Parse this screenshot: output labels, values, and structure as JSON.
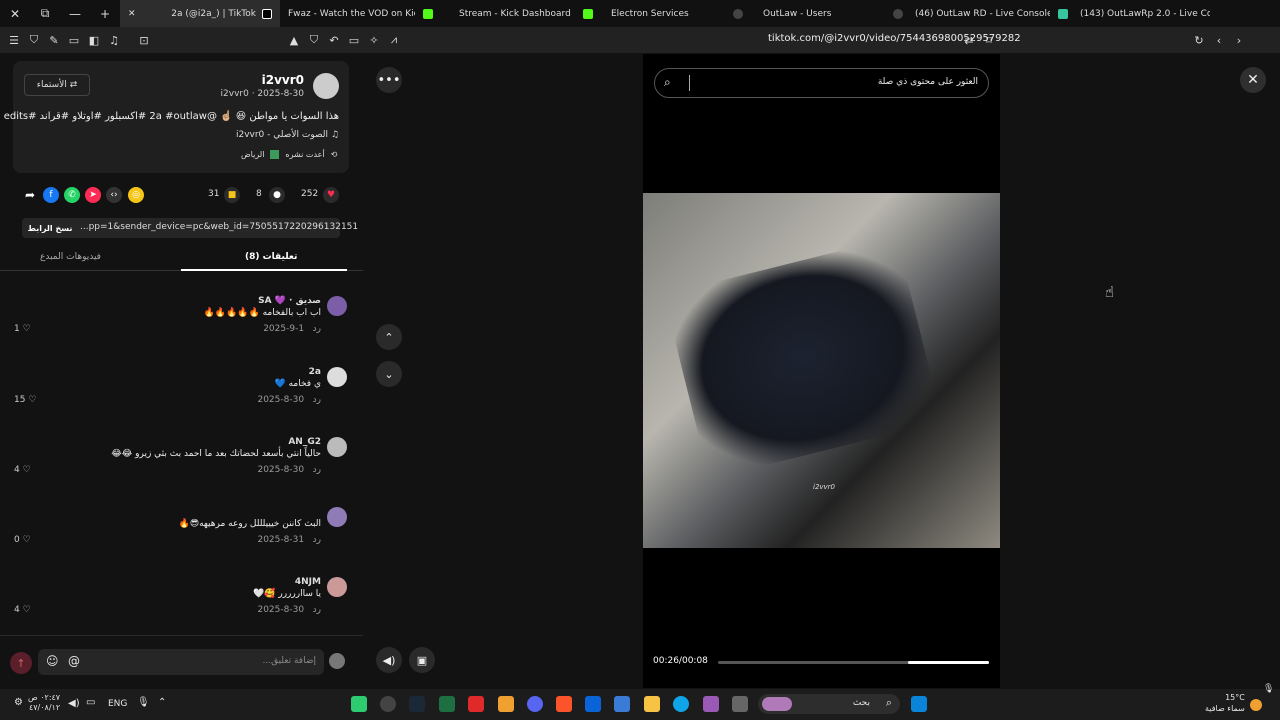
{
  "browser": {
    "tabs": [
      {
        "label": "2a (@i2a_) | TikTok"
      },
      {
        "label": "Fwaz - Watch the VOD on Kick"
      },
      {
        "label": "Stream - Kick Dashboard"
      },
      {
        "label": "Electron Services"
      },
      {
        "label": "OutLaw - Users"
      },
      {
        "label": "(46) OutLaw RD - Live Console"
      },
      {
        "label": "(143) OutLawRp 2.0 - Live Console"
      }
    ],
    "url": "tiktok.com/@i2vvr0/video/7544369800529579282"
  },
  "post": {
    "username": "i2vvr0",
    "meta": "2025-8-30 · i2vvr0",
    "follow_label": "الأستماء ⇄",
    "caption": "هذا السوات يا مواطن 😆 ☝🏼 @2a #outlaw #اكسبلور #اوتلاو #قراند #edits",
    "sound": "الصوت الأصلي - i2vvr0",
    "location": "الرياض",
    "repost": "أعدت نشره",
    "likes": "252",
    "comments": "8",
    "saves": "31",
    "link_text": "...pp=1&sender_device=pc&web_id=7505517220296132151",
    "copy_label": "نسخ الرابط"
  },
  "tabs": {
    "comments_label": "تعليقات (8)",
    "creator_label": "فيديوهات المبدع"
  },
  "comments": [
    {
      "name": "SA 💜 · صديق",
      "text": "اب اب بالفخامه 🔥🔥🔥🔥🔥",
      "date": "2025-9-1",
      "reply": "رد",
      "likes": "1"
    },
    {
      "name": "2a",
      "text": "ي فخامه 💙",
      "date": "2025-8-30",
      "reply": "رد",
      "likes": "15"
    },
    {
      "name": "AN_G2",
      "text": "حالياً انتي بأسعد لحضاتك بعد ما احمد بث بثي زيرو 😂😂",
      "date": "2025-8-30",
      "reply": "رد",
      "likes": "4"
    },
    {
      "name": "",
      "text": "البث كاننن خيييلللل روعه مرهيهه😎🔥",
      "date": "2025-8-31",
      "reply": "رد",
      "likes": "0"
    },
    {
      "name": "4NJM",
      "text": "يا سااررررر 🥰🤍",
      "date": "2025-8-30",
      "reply": "رد",
      "likes": "4"
    }
  ],
  "composer": {
    "placeholder": "إضافة تعليق...",
    "at": "@"
  },
  "player": {
    "search_placeholder": "العثور على محتوى ذي صلة",
    "time": "00:26/00:08",
    "progress_fraction": 0.3,
    "watermark": "i2vvr0"
  },
  "taskbar": {
    "search_label": "بحث",
    "temp": "15°C",
    "weather": "سماء صافية",
    "lang": "ENG",
    "time": "٠٢:٤٧ ص",
    "date": "٤٧/٠٨/١٢"
  },
  "colors": {
    "like": "#fe2c55",
    "save": "#f5c518",
    "link": "#8ab4ff"
  }
}
